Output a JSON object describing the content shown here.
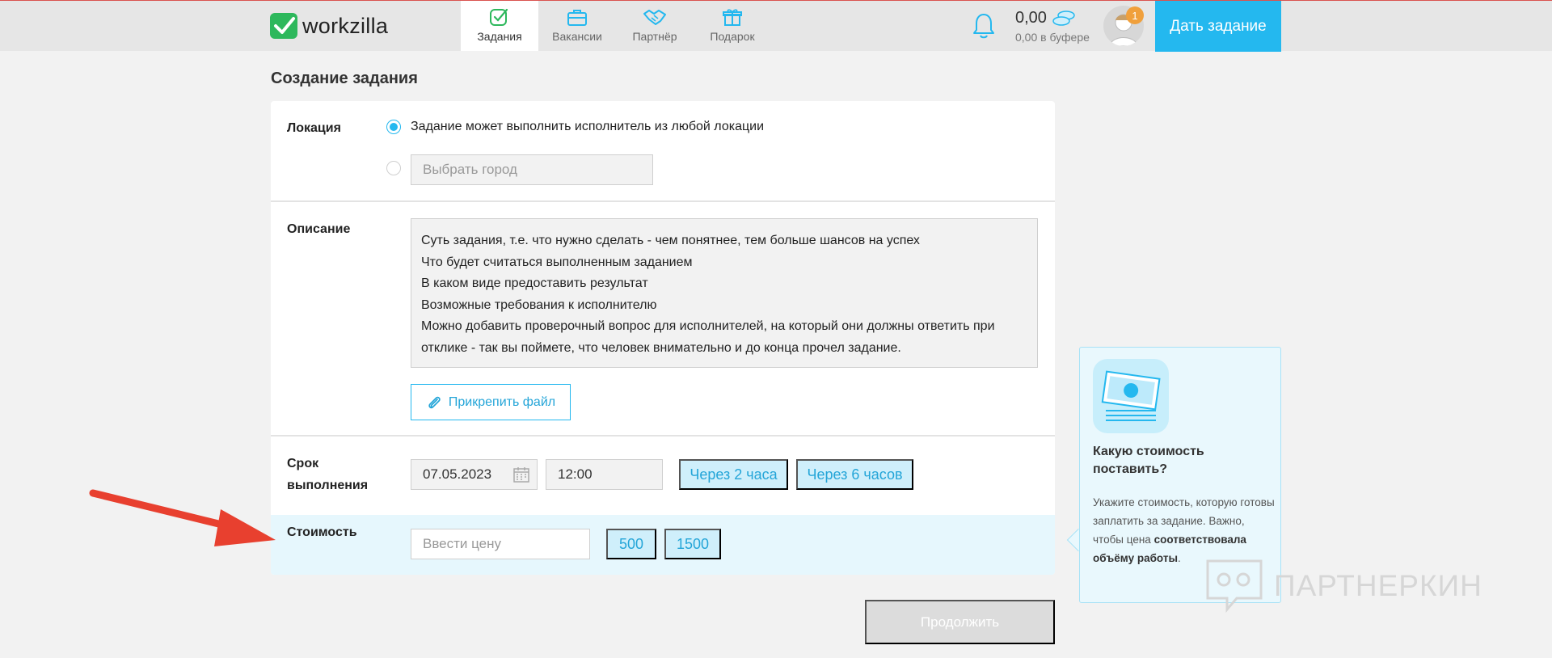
{
  "app": {
    "logo_text": "workzilla"
  },
  "nav": [
    {
      "label": "Задания",
      "icon": "tasks-check-icon",
      "active": true
    },
    {
      "label": "Вакансии",
      "icon": "briefcase-icon",
      "active": false
    },
    {
      "label": "Партнёр",
      "icon": "handshake-icon",
      "active": false
    },
    {
      "label": "Подарок",
      "icon": "gift-icon",
      "active": false
    }
  ],
  "header": {
    "balance": "0,00",
    "buffer": "0,00 в буфере",
    "notification_count": "1",
    "cta_label": "Дать задание"
  },
  "page": {
    "title": "Создание задания"
  },
  "form": {
    "location": {
      "label": "Локация",
      "option_any": "Задание может выполнить исполнитель из любой локации",
      "city_placeholder": "Выбрать город"
    },
    "description": {
      "label": "Описание",
      "lines": [
        "Суть задания, т.е. что нужно сделать - чем понятнее, тем больше шансов на успех",
        "Что будет считаться выполненным заданием",
        "В каком виде предоставить результат",
        "Возможные требования к исполнителю",
        "Можно добавить проверочный вопрос для исполнителей, на который они должны ответить при",
        "отклике - так вы поймете, что человек внимательно и до конца прочел задание."
      ],
      "attach_label": "Прикрепить файл"
    },
    "deadline": {
      "label_line1": "Срок",
      "label_line2": "выполнения",
      "date": "07.05.2023",
      "time": "12:00",
      "quick1": "Через 2 часа",
      "quick2": "Через 6 часов"
    },
    "price": {
      "label": "Стоимость",
      "placeholder": "Ввести цену",
      "quick1": "500",
      "quick2": "1500"
    },
    "continue_label": "Продолжить"
  },
  "tip": {
    "title": "Какую стоимость поставить?",
    "text_plain": "Укажите стоимость, которую готовы заплатить за задание. Важно, чтобы цена",
    "text_bold": "соответствовала объёму работы",
    "text_end": "."
  },
  "watermark": {
    "text": "ПАРТНЕРКИН"
  },
  "colors": {
    "accent": "#24b8ef",
    "brand_green": "#2db85c",
    "arrow": "#e8402f"
  }
}
